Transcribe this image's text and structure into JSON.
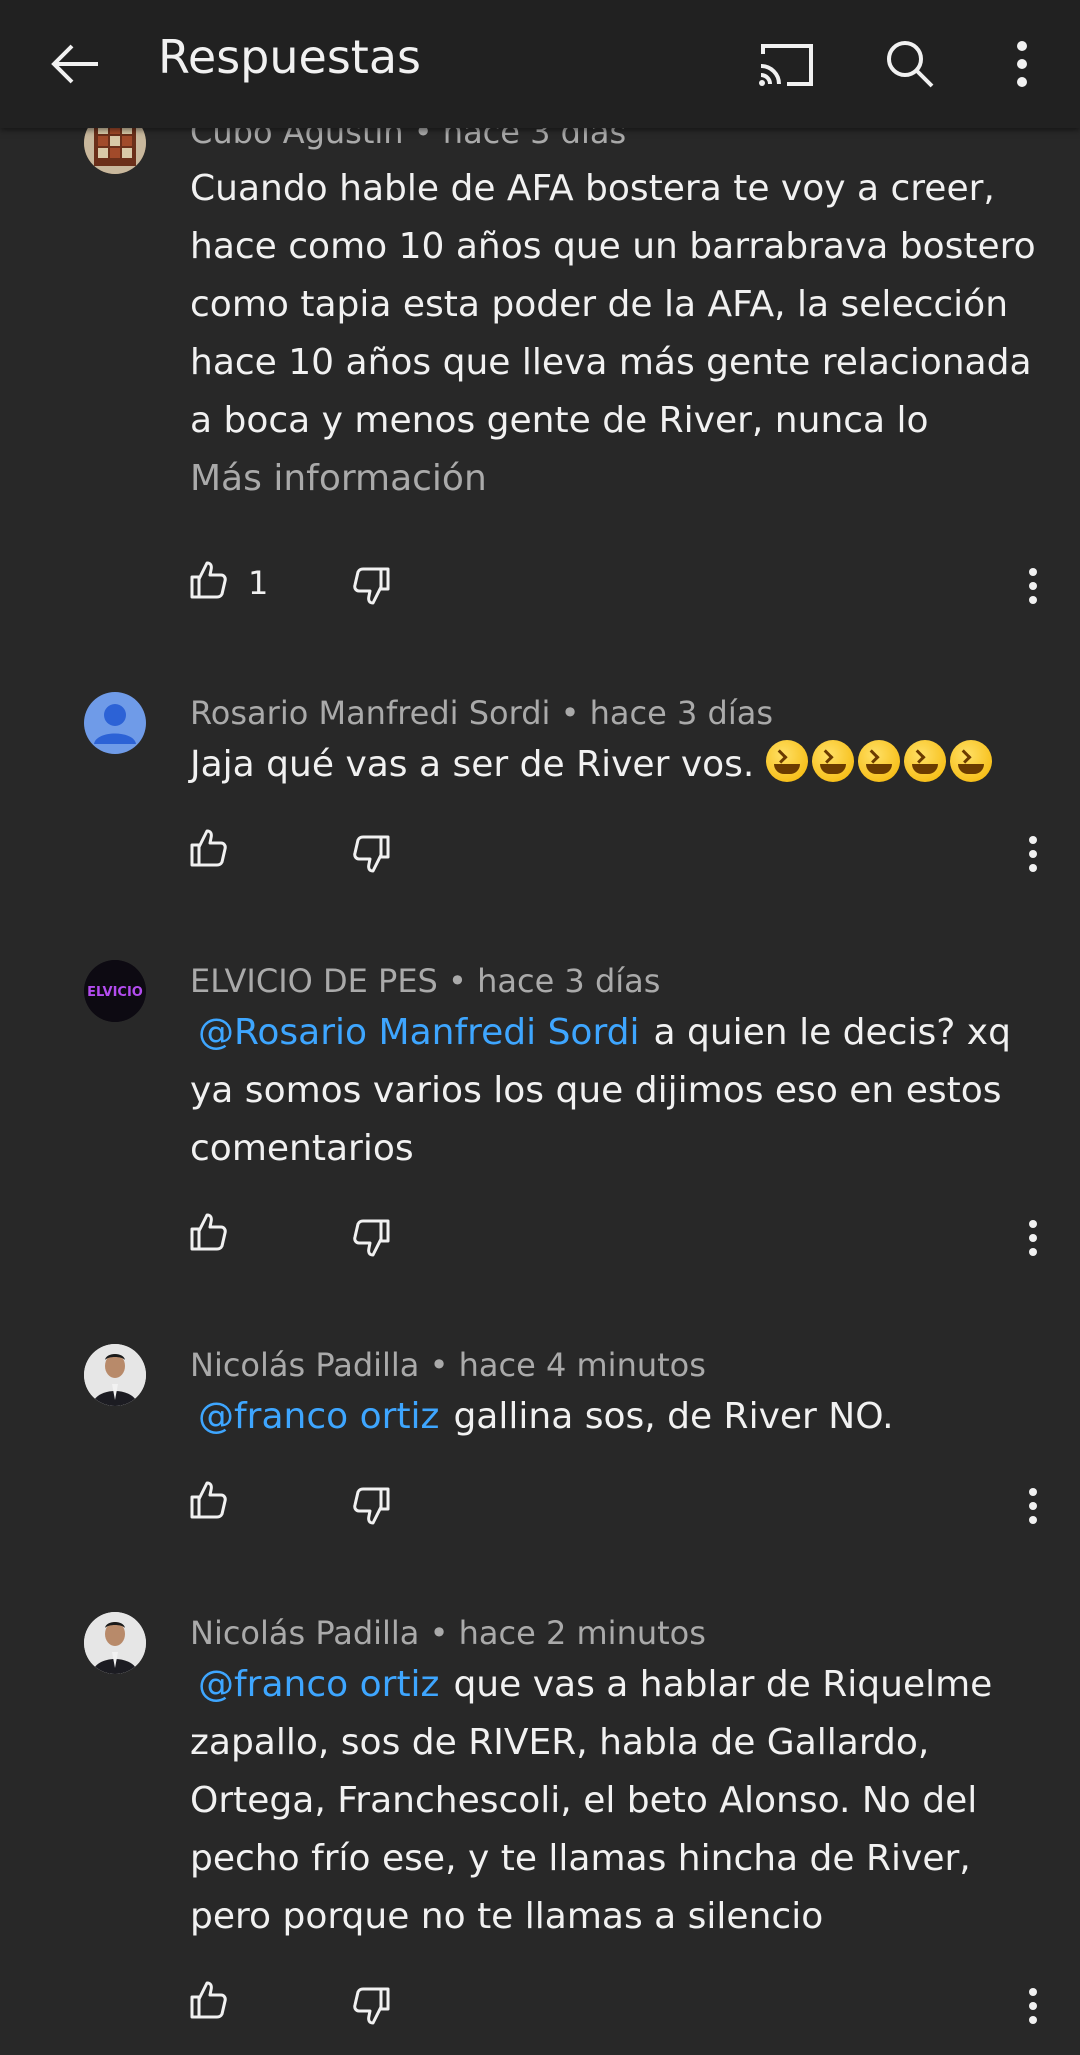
{
  "header": {
    "title": "Respuestas",
    "back_icon": "arrow-left-icon",
    "cast_icon": "cast-icon",
    "search_icon": "search-icon",
    "more_icon": "more-vert-icon"
  },
  "comments": [
    {
      "author": "Cubo Agustin",
      "time": "hace 3 días",
      "text": "Cuando hable de AFA bostera te voy a creer, hace como 10 años que un barrabrava bostero como tapia esta poder de la AFA, la selección hace 10 años que lleva más gente relacionada a boca y menos gente de River, nunca lo",
      "more_label": "Más información",
      "likes": "1"
    },
    {
      "author": "Rosario Manfredi Sordi",
      "time": "hace 3 días",
      "text": "Jaja qué vas a ser de River vos."
    },
    {
      "author": "ELVICIO DE PES",
      "time": "hace 3 días",
      "mention": "@Rosario Manfredi Sordi",
      "text": "a quien le decis? xq ya somos varios los que dijimos eso en estos comentarios",
      "avatar_text": "ELVICIO"
    },
    {
      "author": "Nicolás Padilla",
      "time": "hace 4 minutos",
      "mention": "@franco ortiz",
      "text": "gallina sos, de River NO."
    },
    {
      "author": "Nicolás Padilla",
      "time": "hace 2 minutos",
      "mention": "@franco ortiz",
      "text": "que vas a hablar de Riquelme zapallo, sos de RIVER, habla de Gallardo, Ortega, Franchescoli, el beto Alonso. No del pecho frío ese, y te llamas hincha de River, pero porque no te llamas a silencio"
    }
  ],
  "colors": {
    "background": "#282828",
    "header": "#212121",
    "mention": "#3ea6ff",
    "meta": "#aaaaaa"
  }
}
